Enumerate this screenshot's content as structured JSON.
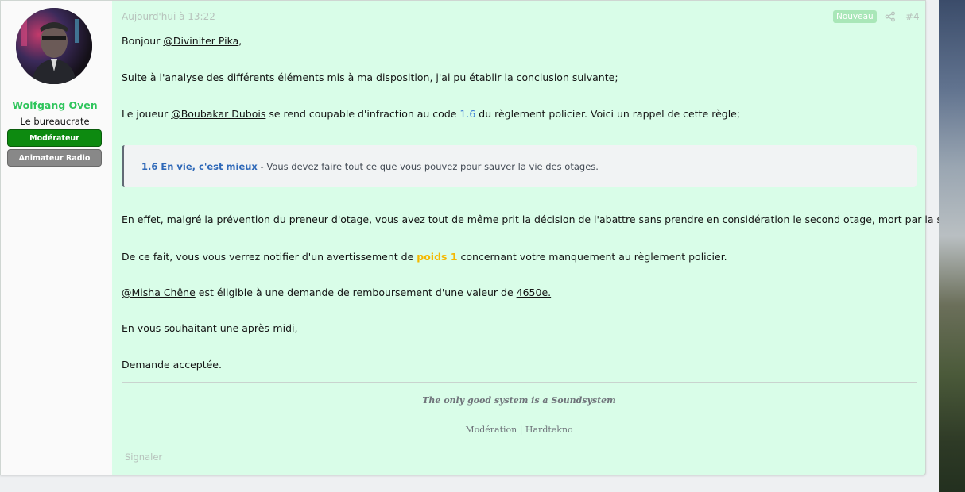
{
  "user": {
    "name": "Wolfgang Oven",
    "title": "Le bureaucrate",
    "banners": [
      "Modérateur",
      "Animateur Radio"
    ]
  },
  "post": {
    "date": "Aujourd'hui à 13:22",
    "badge": "Nouveau",
    "number": "#4",
    "p1": {
      "text": "Bonjour ",
      "mention": "@Diviniter Pika",
      "after": ","
    },
    "p2": "Suite à l'analyse des différents éléments mis à ma disposition, j'ai pu établir la conclusion suivante;",
    "p3": {
      "before": "Le joueur ",
      "mention": "@Boubakar Dubois",
      "middle": " se rend coupable d'infraction au code ",
      "code": "1.6",
      "after": " du règlement policier. Voici un rappel de cette règle;"
    },
    "quote": {
      "rule": "1.6 En vie, c'est mieux",
      "text": " - Vous devez faire tout ce que vous pouvez pour sauver la vie des otages."
    },
    "p4": "En effet, malgré la prévention du preneur d'otage, vous avez tout de même prit la décision de l'abattre sans prendre en considération le second otage, mort par la suite.",
    "p5": {
      "before": "De ce fait, vous vous verrez notifier d'un avertissement de ",
      "weight": "poids 1",
      "after": " concernant votre manquement au règlement policier."
    },
    "p6": {
      "mention": "@Misha Chêne",
      "middle": " est éligible à une demande de remboursement d'une valeur de ",
      "amount": "4650e."
    },
    "p7": "En vous souhaitant une après-midi,",
    "p8": "Demande acceptée.",
    "signature": {
      "line1": "The only good system is a Soundsystem",
      "line2": "Modération | Hardtekno"
    },
    "report": "Signaler"
  },
  "colors": {
    "post_bg": "#d9fde8",
    "username": "#2fc55c",
    "moderator_banner": "#0d8a10",
    "radio_banner": "#888888",
    "code_link": "#3a7bd5",
    "weight": "#f5b800"
  }
}
